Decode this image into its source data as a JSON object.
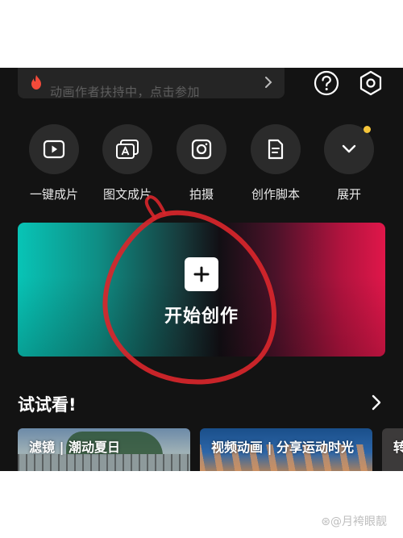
{
  "search": {
    "text": "动画作者扶持中，点击参加"
  },
  "top_icons": {
    "help": "question-circle-icon",
    "settings": "hexagon-gear-icon"
  },
  "actions": [
    {
      "label": "一键成片",
      "icon": "play-icon"
    },
    {
      "label": "图文成片",
      "icon": "text-to-video-icon"
    },
    {
      "label": "拍摄",
      "icon": "camera-icon"
    },
    {
      "label": "创作脚本",
      "icon": "script-icon"
    },
    {
      "label": "展开",
      "icon": "chevron-down-icon",
      "has_badge": true
    }
  ],
  "create": {
    "label": "开始创作",
    "icon": "plus-icon"
  },
  "section": {
    "title": "试试看!"
  },
  "tiles": [
    {
      "caption": "滤镜 | 潮动夏日"
    },
    {
      "caption": "视频动画 | 分享运动时光"
    },
    {
      "caption": "转"
    }
  ],
  "watermark": "⊛@月袴眼靓",
  "colors": {
    "background": "#131313",
    "accent_red": "#e0174a",
    "accent_teal": "#08c4b6",
    "badge": "#f5c53a",
    "annotation": "#d8262b"
  }
}
